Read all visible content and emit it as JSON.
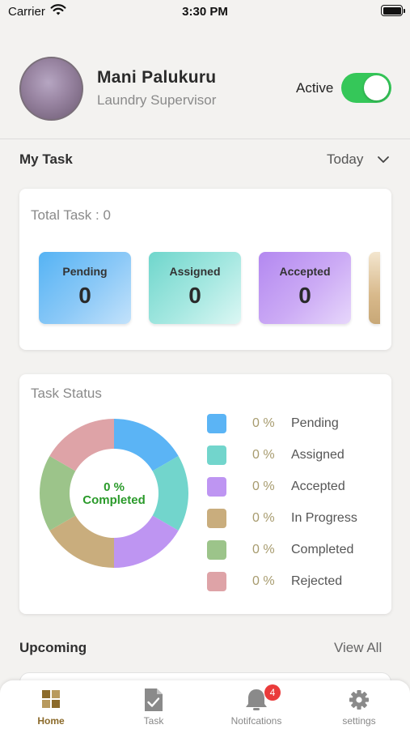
{
  "status_bar": {
    "carrier": "Carrier",
    "time": "3:30 PM"
  },
  "profile": {
    "name": "Mani Palukuru",
    "role": "Laundry Supervisor",
    "status_label": "Active",
    "status_on": true
  },
  "my_task": {
    "title": "My Task",
    "filter_value": "Today",
    "total_label": "Total Task : 0"
  },
  "task_tiles": [
    {
      "label": "Pending",
      "value": "0"
    },
    {
      "label": "Assigned",
      "value": "0"
    },
    {
      "label": "Accepted",
      "value": "0"
    }
  ],
  "task_status": {
    "title": "Task Status",
    "center_value": "0 %",
    "center_label": "Completed",
    "legend": [
      {
        "label": "Pending",
        "percent": "0 %",
        "color": "#5bb4f5"
      },
      {
        "label": "Assigned",
        "percent": "0 %",
        "color": "#72d5cc"
      },
      {
        "label": "Accepted",
        "percent": "0 %",
        "color": "#be95f2"
      },
      {
        "label": "In Progress",
        "percent": "0 %",
        "color": "#c9ad7d"
      },
      {
        "label": "Completed",
        "percent": "0 %",
        "color": "#9cc48a"
      },
      {
        "label": "Rejected",
        "percent": "0 %",
        "color": "#dea3a7"
      }
    ]
  },
  "upcoming": {
    "title": "Upcoming",
    "link": "View All"
  },
  "tabbar": {
    "items": [
      {
        "label": "Home",
        "icon": "grid-icon",
        "active": true
      },
      {
        "label": "Task",
        "icon": "clipboard-check-icon",
        "active": false
      },
      {
        "label": "Notifcations",
        "icon": "bell-icon",
        "active": false,
        "badge": "4"
      },
      {
        "label": "settings",
        "icon": "gear-icon",
        "active": false
      }
    ]
  }
}
